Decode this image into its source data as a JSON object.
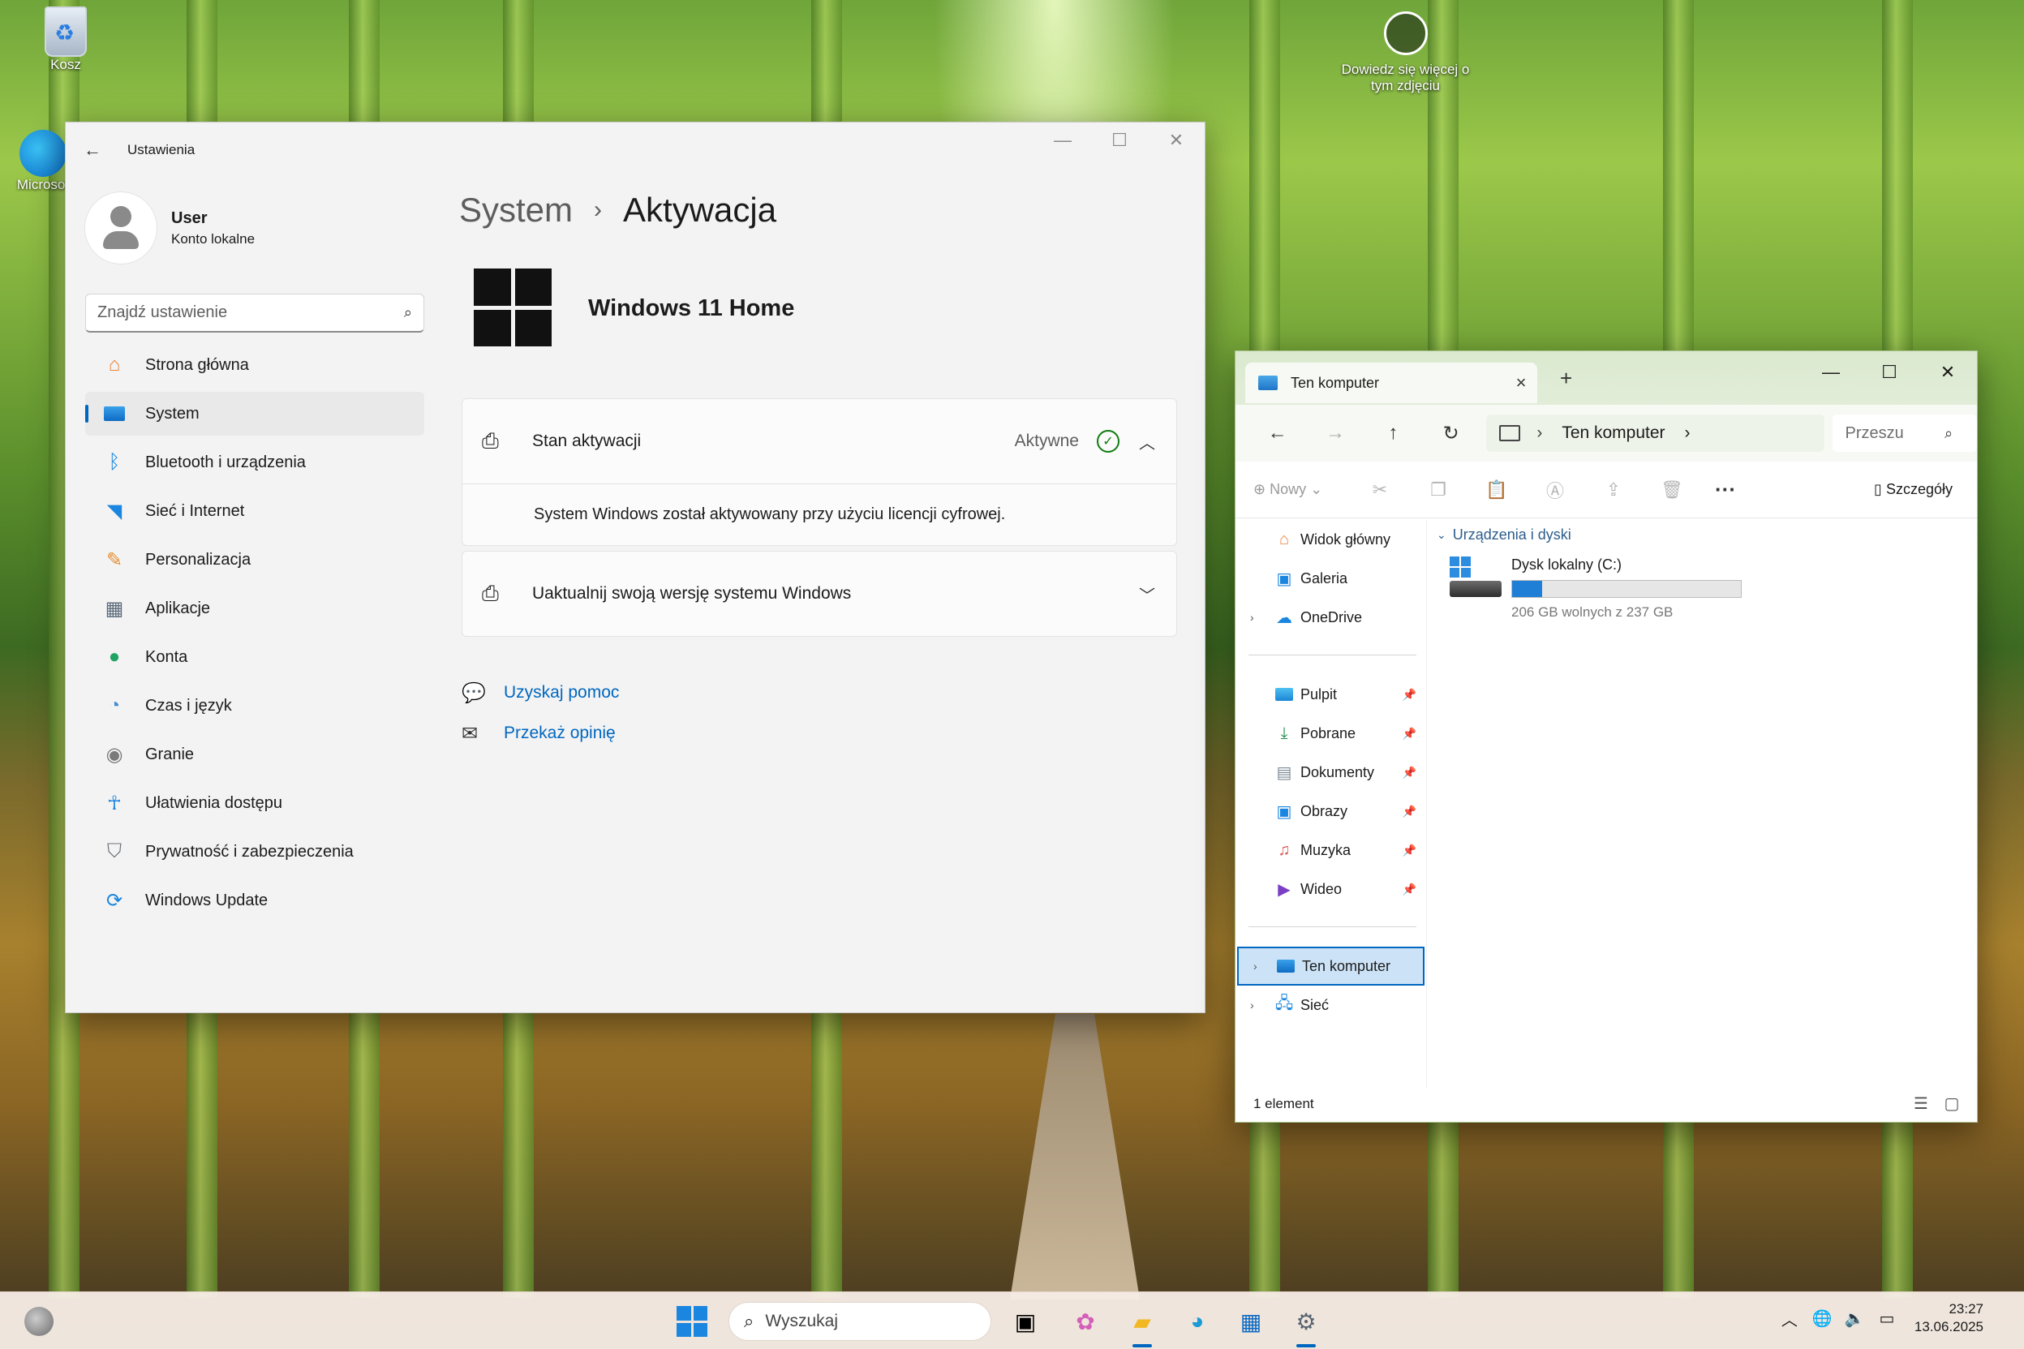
{
  "desktop": {
    "recycle_bin_label": "Kosz",
    "edge_label": "Microsof",
    "learn_more_label": "Dowiedz się więcej o tym zdjęciu"
  },
  "settings": {
    "title": "Ustawienia",
    "user": {
      "name": "User",
      "account_type": "Konto lokalne"
    },
    "search_placeholder": "Znajdź ustawienie",
    "nav": [
      {
        "label": "Strona główna",
        "icon": "home-icon",
        "color": "#e8843c"
      },
      {
        "label": "System",
        "icon": "system-icon",
        "color": "#0f78d4"
      },
      {
        "label": "Bluetooth i urządzenia",
        "icon": "bluetooth-icon",
        "color": "#1a86df"
      },
      {
        "label": "Sieć i Internet",
        "icon": "wifi-icon",
        "color": "#1a86df"
      },
      {
        "label": "Personalizacja",
        "icon": "brush-icon",
        "color": "#e48d2f"
      },
      {
        "label": "Aplikacje",
        "icon": "apps-icon",
        "color": "#5a6b7c"
      },
      {
        "label": "Konta",
        "icon": "person-icon",
        "color": "#21a366"
      },
      {
        "label": "Czas i język",
        "icon": "globe-clock-icon",
        "color": "#3e8ccf"
      },
      {
        "label": "Granie",
        "icon": "gamepad-icon",
        "color": "#7a7a7a"
      },
      {
        "label": "Ułatwienia dostępu",
        "icon": "accessibility-icon",
        "color": "#1a86df"
      },
      {
        "label": "Prywatność i zabezpieczenia",
        "icon": "shield-icon",
        "color": "#6c7178"
      },
      {
        "label": "Windows Update",
        "icon": "update-icon",
        "color": "#1a86df"
      }
    ],
    "active_nav": "System",
    "breadcrumb": {
      "parent": "System",
      "current": "Aktywacja"
    },
    "edition": "Windows 11 Home",
    "activation_card": {
      "label": "Stan aktywacji",
      "status": "Aktywne",
      "detail": "System Windows został aktywowany przy użyciu licencji cyfrowej."
    },
    "upgrade_card": {
      "label": "Uaktualnij swoją wersję systemu Windows"
    },
    "links": {
      "help": "Uzyskaj pomoc",
      "feedback": "Przekaż opinię"
    }
  },
  "explorer": {
    "tab_title": "Ten komputer",
    "address": "Ten komputer",
    "search_placeholder": "Przeszu",
    "toolbar": {
      "new_label": "Nowy",
      "details_label": "Szczegóły"
    },
    "quick": [
      {
        "label": "Widok główny",
        "icon": "home-icon"
      },
      {
        "label": "Galeria",
        "icon": "gallery-icon"
      },
      {
        "label": "OneDrive",
        "icon": "cloud-icon"
      }
    ],
    "pinned": [
      {
        "label": "Pulpit",
        "icon": "desktop-folder-icon"
      },
      {
        "label": "Pobrane",
        "icon": "download-icon"
      },
      {
        "label": "Dokumenty",
        "icon": "documents-icon"
      },
      {
        "label": "Obrazy",
        "icon": "pictures-icon"
      },
      {
        "label": "Muzyka",
        "icon": "music-icon"
      },
      {
        "label": "Wideo",
        "icon": "video-icon"
      }
    ],
    "locations": [
      {
        "label": "Ten komputer",
        "icon": "pc-icon"
      },
      {
        "label": "Sieć",
        "icon": "network-icon"
      }
    ],
    "group_label": "Urządzenia i dyski",
    "drive": {
      "name": "Dysk lokalny (C:)",
      "free_text": "206 GB wolnych z 237 GB",
      "used_fraction": 0.13
    },
    "status_count": "1 element"
  },
  "taskbar": {
    "search_placeholder": "Wyszukaj",
    "time": "23:27",
    "date": "13.06.2025"
  }
}
